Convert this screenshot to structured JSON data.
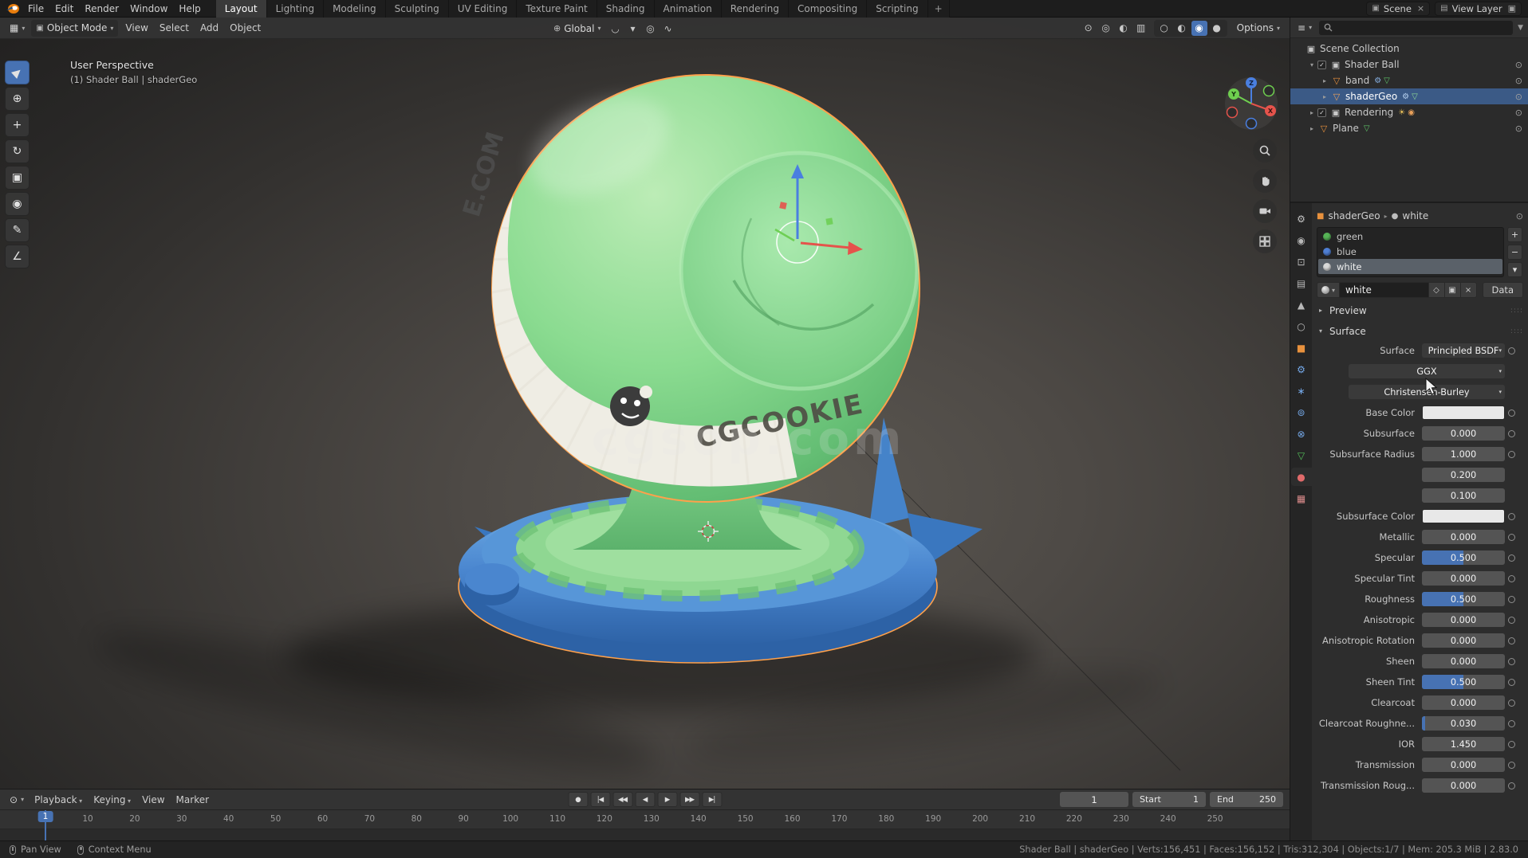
{
  "topbar": {
    "menus": [
      "File",
      "Edit",
      "Render",
      "Window",
      "Help"
    ],
    "workspaces": [
      "Layout",
      "Lighting",
      "Modeling",
      "Sculpting",
      "UV Editing",
      "Texture Paint",
      "Shading",
      "Animation",
      "Rendering",
      "Compositing",
      "Scripting"
    ],
    "active_workspace": "Layout",
    "add_workspace": "+",
    "scene": {
      "icon": "▣",
      "label": "Scene",
      "close": "×"
    },
    "view_layer": {
      "icon": "▤",
      "label": "View Layer",
      "copy": "▣"
    }
  },
  "viewport": {
    "header": {
      "editor_icon": "▦",
      "editor_arrow": "▾",
      "mode_icon": "▣",
      "mode": "Object Mode",
      "mode_arrow": "▾",
      "menus": [
        "View",
        "Select",
        "Add",
        "Object"
      ],
      "orientation_icon": "⊕",
      "orientation": "Global",
      "orientation_arrow": "▾",
      "center_icons": [
        {
          "name": "snap-magnet-icon",
          "glyph": "◡"
        },
        {
          "name": "snap-dropdown-arrow",
          "glyph": "▾"
        },
        {
          "name": "proportional-editing-icon",
          "glyph": "◎"
        },
        {
          "name": "falloff-dropdown-icon",
          "glyph": "∿"
        }
      ],
      "right_icons": [
        {
          "name": "object-visibility-icon",
          "glyph": "⊙"
        },
        {
          "name": "gizmos-icon",
          "glyph": "◎"
        },
        {
          "name": "overlays-icon",
          "glyph": "◐"
        },
        {
          "name": "xray-toggle-icon",
          "glyph": "▥"
        }
      ],
      "shading_modes": [
        {
          "name": "shading-wireframe-icon",
          "glyph": "○"
        },
        {
          "name": "shading-solid-icon",
          "glyph": "◐"
        },
        {
          "name": "shading-material-icon",
          "glyph": "◉",
          "active": true
        },
        {
          "name": "shading-rendered-icon",
          "glyph": "●"
        }
      ],
      "options": "Options",
      "options_arrow": "▾"
    },
    "overlay": {
      "perspective": "User Perspective",
      "active_object": "(1) Shader Ball | shaderGeo",
      "watermark": "cgsop.com"
    },
    "ball": {
      "band_text_top": "E.COM",
      "band_text_front": "CGCOOKIE"
    },
    "tools": [
      {
        "name": "select-box-tool",
        "glyph": "▶",
        "rot": true,
        "active": true
      },
      {
        "name": "cursor-tool",
        "glyph": "⊕"
      },
      {
        "name": "move-tool",
        "glyph": "+"
      },
      {
        "name": "rotate-tool",
        "glyph": "↻"
      },
      {
        "name": "scale-tool",
        "glyph": "▣"
      },
      {
        "name": "transform-tool",
        "glyph": "◉"
      },
      {
        "name": "annotate-tool",
        "glyph": "✎"
      },
      {
        "name": "measure-tool",
        "glyph": "∠"
      }
    ],
    "axis_labels": {
      "x": "X",
      "y": "Y",
      "z": "Z"
    }
  },
  "outliner": {
    "editor_icon": "≡",
    "editor_arrow": "▾",
    "search_placeholder": "",
    "filter_icon": "▼",
    "rows": [
      {
        "label": "Scene Collection",
        "depth": 0,
        "expander": "",
        "icon": "collection-icon",
        "glyph": "▣",
        "color": "#c9c9c9",
        "eye": false
      },
      {
        "label": "Shader Ball",
        "depth": 1,
        "expander": "▾",
        "checkbox": true,
        "icon": "collection-icon",
        "glyph": "▣",
        "color": "#c9c9c9",
        "eye": true
      },
      {
        "label": "band",
        "depth": 2,
        "expander": "▸",
        "icon": "mesh-object-icon",
        "glyph": "▽",
        "color": "#e8913d",
        "extras": [
          {
            "name": "modifier-icon",
            "glyph": "⚙",
            "color": "#8ab4e8"
          },
          {
            "name": "mesh-data-icon",
            "glyph": "▽",
            "color": "#5fc468"
          }
        ],
        "eye": true
      },
      {
        "label": "shaderGeo",
        "depth": 2,
        "expander": "▸",
        "icon": "mesh-object-icon",
        "glyph": "▽",
        "color": "#f0a35a",
        "selected": true,
        "extras": [
          {
            "name": "modifier-icon",
            "glyph": "⚙",
            "color": "#b8d2f0"
          },
          {
            "name": "mesh-data-icon",
            "glyph": "▽",
            "color": "#8fd998"
          }
        ],
        "eye": true
      },
      {
        "label": "Rendering",
        "depth": 1,
        "expander": "▸",
        "checkbox": true,
        "icon": "collection-icon",
        "glyph": "▣",
        "color": "#c9c9c9",
        "extras": [
          {
            "name": "light-icon",
            "glyph": "☀",
            "color": "#e8c05a"
          },
          {
            "name": "camera-icon",
            "glyph": "◉",
            "color": "#e8a05a"
          }
        ],
        "eye": true
      },
      {
        "label": "Plane",
        "depth": 1,
        "expander": "▸",
        "icon": "mesh-object-icon",
        "glyph": "▽",
        "color": "#e8913d",
        "extras": [
          {
            "name": "mesh-data-icon",
            "glyph": "▽",
            "color": "#5fc468"
          }
        ],
        "eye": true
      }
    ]
  },
  "properties": {
    "tabs": [
      {
        "name": "tool-tab",
        "glyph": "⚙",
        "color": "#c2c2c2"
      },
      {
        "name": "render-tab",
        "glyph": "◉",
        "color": "#b8b8b8"
      },
      {
        "name": "output-tab",
        "glyph": "⊡",
        "color": "#b8b8b8"
      },
      {
        "name": "view-layer-tab",
        "glyph": "▤",
        "color": "#b8b8b8"
      },
      {
        "name": "scene-tab",
        "glyph": "▲",
        "color": "#b8b8b8"
      },
      {
        "name": "world-tab",
        "glyph": "○",
        "color": "#b8b8b8"
      },
      {
        "name": "object-tab",
        "glyph": "■",
        "color": "#e8913d"
      },
      {
        "name": "modifiers-tab",
        "glyph": "⚙",
        "color": "#74a8e8"
      },
      {
        "name": "particles-tab",
        "glyph": "∗",
        "color": "#74a8e8"
      },
      {
        "name": "physics-tab",
        "glyph": "⊚",
        "color": "#74a8e8"
      },
      {
        "name": "constraints-tab",
        "glyph": "⊗",
        "color": "#74a8e8"
      },
      {
        "name": "object-data-tab",
        "glyph": "▽",
        "color": "#54c05a"
      },
      {
        "name": "material-tab",
        "glyph": "●",
        "color": "#e06a6a",
        "active": true
      },
      {
        "name": "texture-tab",
        "glyph": "▦",
        "color": "#d98a8a"
      }
    ],
    "breadcrumb": {
      "object_icon": "■",
      "object": "shaderGeo",
      "separator": "▸",
      "material_icon": "●",
      "material": "white",
      "pin_icon": "⊙"
    },
    "slots": [
      {
        "name": "green",
        "color": "#56b356"
      },
      {
        "name": "blue",
        "color": "#4f7fd4"
      },
      {
        "name": "white",
        "color": "#d8d8d8",
        "selected": true
      }
    ],
    "slot_buttons": {
      "add": "+",
      "remove": "−",
      "specials": "▾"
    },
    "datablock": {
      "browse_icon": "▾",
      "name": "white",
      "shield": "◇",
      "copy": "▣",
      "unlink": "×",
      "data": "Data"
    },
    "sections": {
      "preview_arrow": "▸",
      "preview": "Preview",
      "surface_arrow": "▾",
      "surface": "Surface",
      "handle": "::::"
    },
    "rows": [
      {
        "label": "Surface",
        "type": "select",
        "value": "Principled BSDF",
        "dot": true
      },
      {
        "label": "",
        "type": "select-wide",
        "value": "GGX",
        "dot": false
      },
      {
        "label": "",
        "type": "select-wide",
        "value": "Christensen-Burley",
        "dot": false
      },
      {
        "label": "Base Color",
        "type": "color",
        "value": "#e8e8e8",
        "dot": true
      },
      {
        "label": "Subsurface",
        "type": "slider",
        "value": "0.000",
        "fill": 0,
        "dot": true
      },
      {
        "label": "Subsurface Radius",
        "type": "number",
        "value": "1.000",
        "dot": true
      },
      {
        "label": "",
        "type": "number",
        "value": "0.200",
        "dot": false
      },
      {
        "label": "",
        "type": "number",
        "value": "0.100",
        "dot": false
      },
      {
        "label": "Subsurface Color",
        "type": "color",
        "value": "#e8e8e8",
        "dot": true
      },
      {
        "label": "Metallic",
        "type": "slider",
        "value": "0.000",
        "fill": 0,
        "dot": true
      },
      {
        "label": "Specular",
        "type": "slider",
        "value": "0.500",
        "fill": 50,
        "dot": true
      },
      {
        "label": "Specular Tint",
        "type": "slider",
        "value": "0.000",
        "fill": 0,
        "dot": true
      },
      {
        "label": "Roughness",
        "type": "slider",
        "value": "0.500",
        "fill": 50,
        "dot": true
      },
      {
        "label": "Anisotropic",
        "type": "slider",
        "value": "0.000",
        "fill": 0,
        "dot": true
      },
      {
        "label": "Anisotropic Rotation",
        "type": "slider",
        "value": "0.000",
        "fill": 0,
        "dot": true
      },
      {
        "label": "Sheen",
        "type": "slider",
        "value": "0.000",
        "fill": 0,
        "dot": true
      },
      {
        "label": "Sheen Tint",
        "type": "slider",
        "value": "0.500",
        "fill": 50,
        "dot": true
      },
      {
        "label": "Clearcoat",
        "type": "slider",
        "value": "0.000",
        "fill": 0,
        "dot": true
      },
      {
        "label": "Clearcoat Roughne...",
        "type": "slider",
        "value": "0.030",
        "fill": 4,
        "dot": true
      },
      {
        "label": "IOR",
        "type": "number",
        "value": "1.450",
        "dot": true
      },
      {
        "label": "Transmission",
        "type": "slider",
        "value": "0.000",
        "fill": 0,
        "dot": true
      },
      {
        "label": "Transmission Roug...",
        "type": "slider",
        "value": "0.000",
        "fill": 0,
        "dot": true
      }
    ]
  },
  "timeline": {
    "editor_icon": "⊙",
    "editor_arrow": "▾",
    "menus": [
      {
        "label": "Playback",
        "arrow": "▾"
      },
      {
        "label": "Keying",
        "arrow": "▾"
      },
      {
        "label": "View"
      },
      {
        "label": "Marker"
      }
    ],
    "buttons": [
      {
        "name": "auto-keying-toggle",
        "glyph": "●"
      },
      {
        "name": "jump-to-start-button",
        "glyph": "|◀"
      },
      {
        "name": "prev-keyframe-button",
        "glyph": "◀◀"
      },
      {
        "name": "play-reverse-button",
        "glyph": "◀"
      },
      {
        "name": "play-button",
        "glyph": "▶"
      },
      {
        "name": "next-keyframe-button",
        "glyph": "▶▶"
      },
      {
        "name": "jump-to-end-button",
        "glyph": "▶|"
      }
    ],
    "current_frame": "1",
    "start": {
      "label": "Start",
      "value": "1"
    },
    "end": {
      "label": "End",
      "value": "250"
    },
    "playhead": "1",
    "ticks": [
      "10",
      "20",
      "30",
      "40",
      "50",
      "60",
      "70",
      "80",
      "90",
      "100",
      "110",
      "120",
      "130",
      "140",
      "150",
      "160",
      "170",
      "180",
      "190",
      "200",
      "210",
      "220",
      "230",
      "240",
      "250"
    ]
  },
  "statusbar": {
    "hints": [
      {
        "label": "Pan View",
        "icon": "middle-mouse-icon",
        "cls": "mid"
      },
      {
        "label": "Context Menu",
        "icon": "right-mouse-icon",
        "cls": "right"
      }
    ],
    "stats": "Shader Ball | shaderGeo | Verts:156,451 | Faces:156,152 | Tris:312,304 | Objects:1/7 | Mem: 205.3 MiB | 2.83.0"
  }
}
